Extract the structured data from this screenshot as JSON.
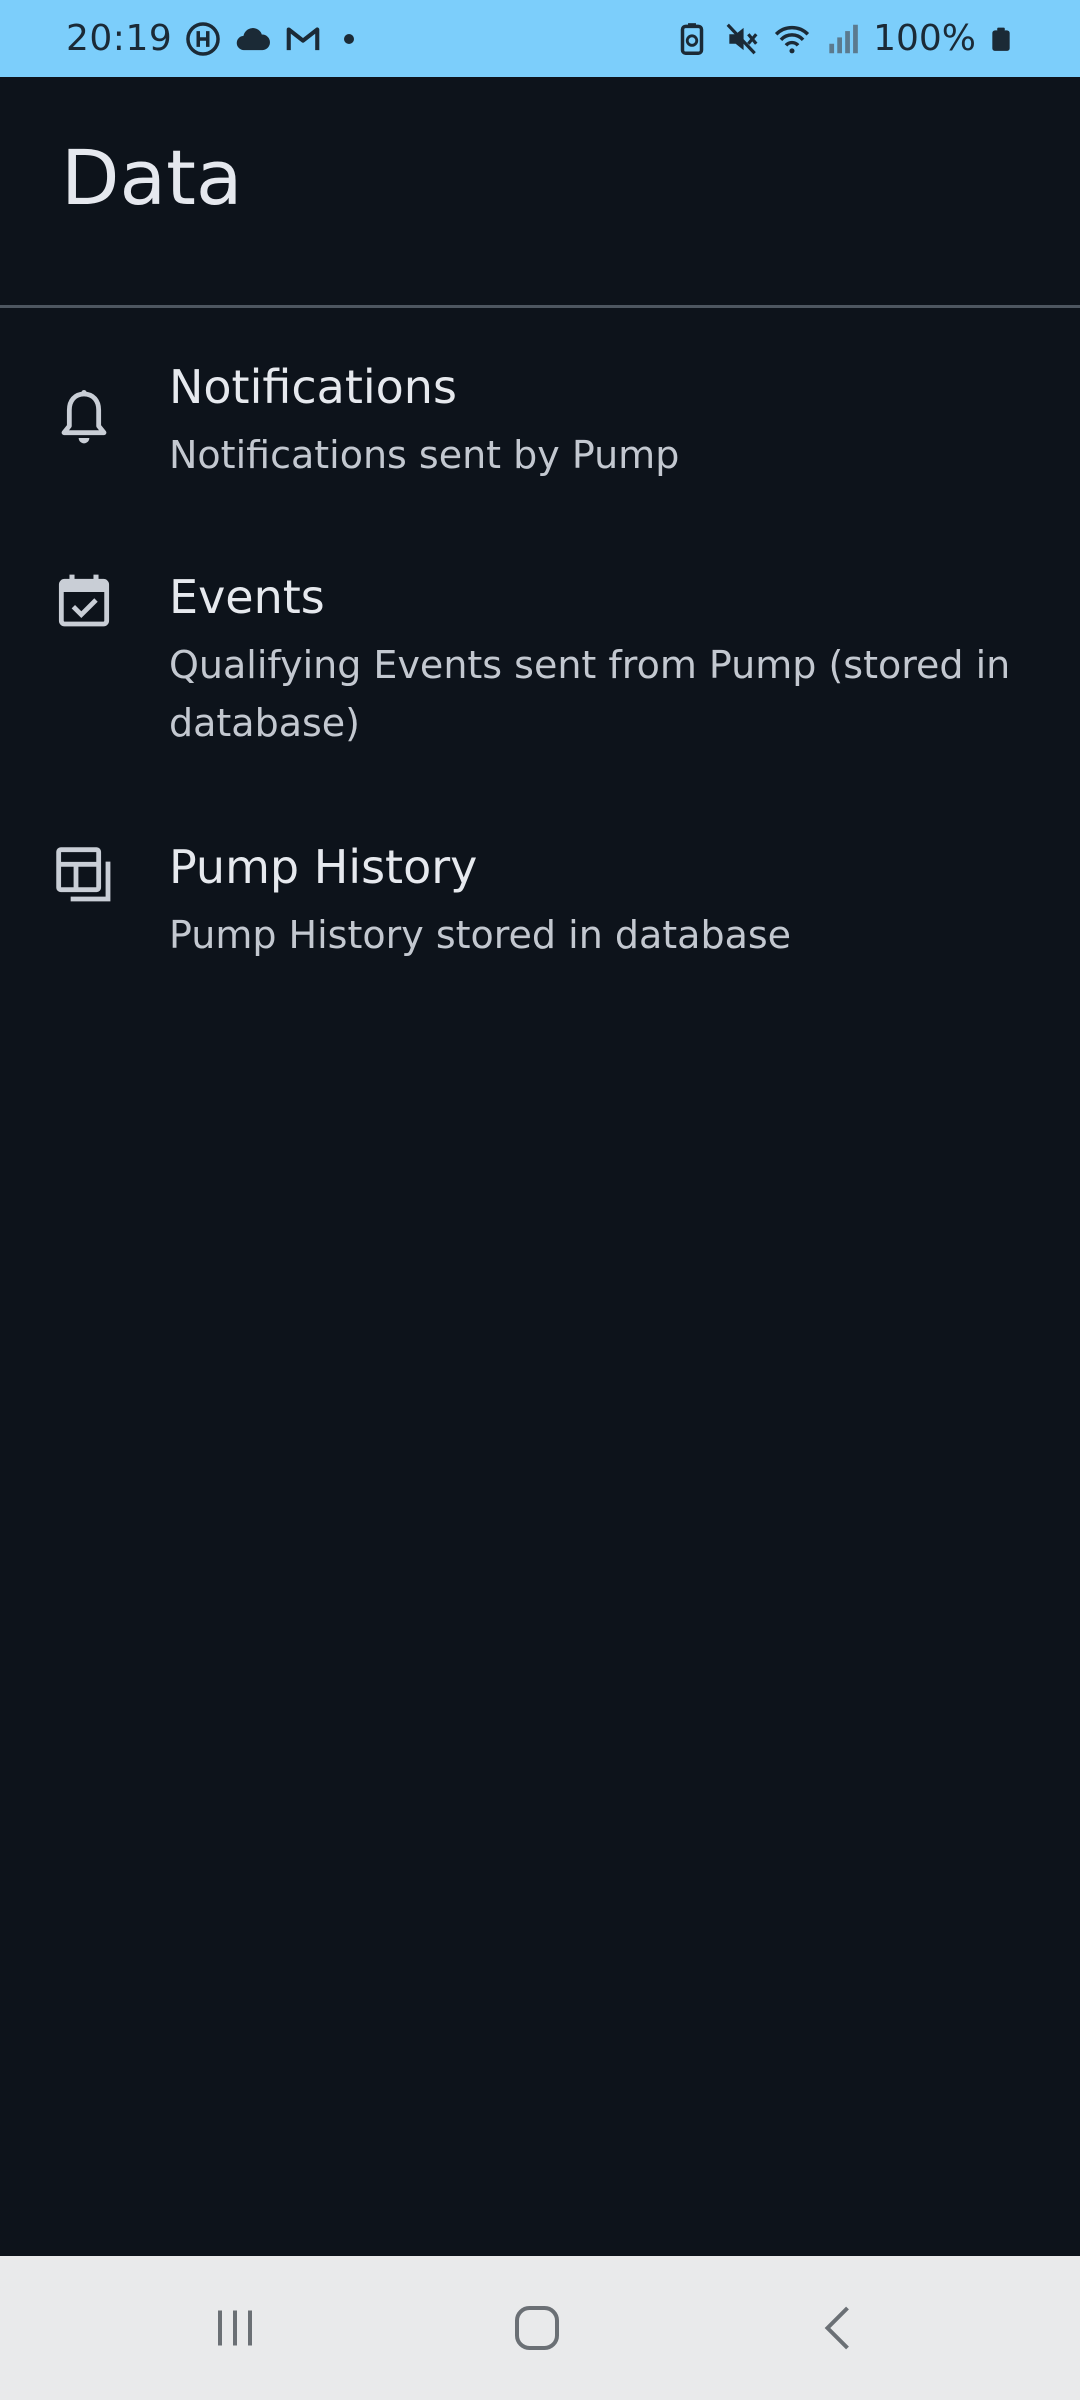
{
  "status_bar": {
    "time": "20:19",
    "battery_percent": "100%",
    "left_icons": [
      "vpn-icon",
      "cloud-icon",
      "gmail-icon",
      "dot-indicator"
    ],
    "right_icons": [
      "battery-saver-icon",
      "mute-icon",
      "wifi-icon",
      "signal-icon",
      "battery-icon"
    ]
  },
  "header": {
    "title": "Data"
  },
  "items": [
    {
      "icon": "bell-icon",
      "title": "Notifications",
      "subtitle": "Notifications sent by Pump"
    },
    {
      "icon": "calendar-check-icon",
      "title": "Events",
      "subtitle": "Qualifying Events sent from Pump (stored in database)"
    },
    {
      "icon": "dashboard-layout-icon",
      "title": "Pump History",
      "subtitle": "Pump History stored in database"
    }
  ],
  "nav_bar": {
    "buttons": [
      "recents-icon",
      "home-icon",
      "back-icon"
    ]
  },
  "colors": {
    "background": "#0d131b",
    "status_bar": "#7ccefb",
    "nav_bar": "#e9eaeb",
    "title_text": "#e5e8ee",
    "subtitle_text": "#c3c8d0"
  }
}
